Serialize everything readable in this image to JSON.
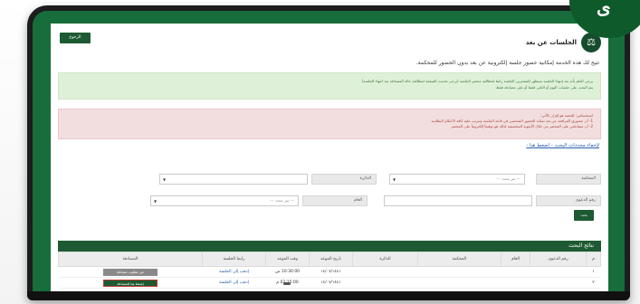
{
  "badge": {
    "text": "ى"
  },
  "page": {
    "back_label": "الرجوع",
    "title": "الجلسات عن بعد",
    "description": "تتيح لك هذه الخدمة إمكانية حضور جلسة إلكترونية عن بعد بدون الحضور للمحكمة.",
    "green_alert_line1": "يرجى العلم بأنه بعد إنتهاء الجلسة سيظهر للمشترين الجلسة رابط لمطالعة محضر الجلسة (يرجى تحديث الصفحة لمطالعة حالة المصادقة بعد انتهاء الجلسة)",
    "green_alert_line2": "يتم البحث على جلسات اليوم أو الثاني فقط أو على مصادقة فقط",
    "red_alert_line1": "استحساس: للحصة هو إقرار بالآتي:",
    "red_alert_line2": "1- أن حضوري المرافعة عن بعد بمثابة الحضور الشخصي في قاعة الجلسة ونترتب عليه كافة الأحكام النظامية",
    "red_alert_line3": "2- أن مصادقتي على المحضر من خلال الأيقونة المخصصة لذلك هو توقيعاً إلكترونياً على المحضر",
    "toggle_link": "لإخفاء محددات البحث - اضغط هنا -"
  },
  "form": {
    "court_label": "المحكمة",
    "court_value": "--- غير محدد ---",
    "circuit_label": "الدائرة",
    "circuit_value": "",
    "case_label": "رقم الدعوى",
    "case_value": "",
    "year_label": "العام",
    "year_value": "--- غير محدد ---",
    "search_label": "بحث"
  },
  "results": {
    "title": "نتائج البحث",
    "columns": [
      "م",
      "رقم الدعوى",
      "العام",
      "المحكمة",
      "الدائرة",
      "تاريخ الموعد",
      "وقت الموعد",
      "رابط الجلسة",
      "المصادقة"
    ],
    "rows": [
      {
        "index": "١",
        "case": "",
        "year": "",
        "court": "",
        "circuit": "",
        "date": "١٤/٠٧/١٤٤١",
        "time": "10:30:00 ص",
        "link": "إذهب إلى الجلسة",
        "action": "غير مطلوب مصادقة"
      },
      {
        "index": "٢",
        "case": "",
        "year": "",
        "court": "",
        "circuit": "",
        "date": "١٤/٠٧/١٤٤١",
        "time": "02:15:00 م",
        "link": "إذهب إلى الجلسة",
        "action": "إضغط هنا للمصادقة"
      }
    ]
  }
}
